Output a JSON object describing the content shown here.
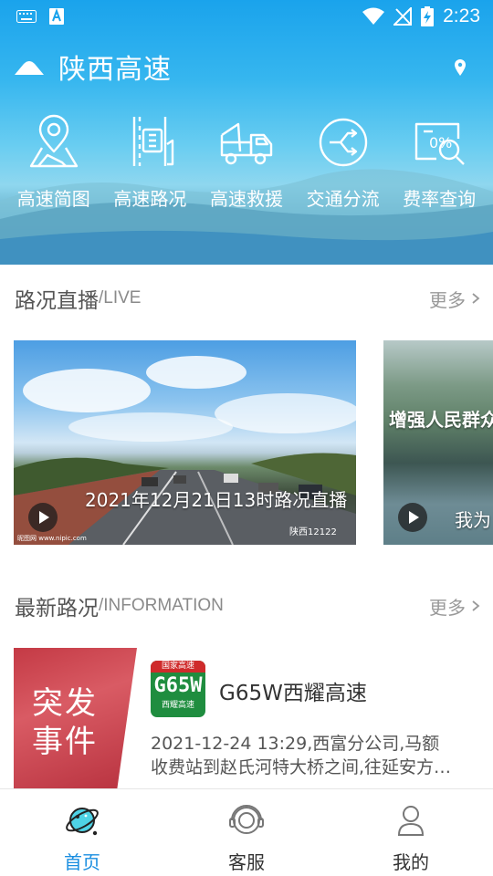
{
  "status_bar": {
    "time": "2:23",
    "left_icons": [
      "keyboard-icon",
      "text-a-icon"
    ],
    "right_icons": [
      "wifi-icon",
      "no-signal-icon",
      "battery-charging-icon"
    ]
  },
  "header": {
    "title": "陕西高速",
    "cloud_icon": "cloud-icon",
    "location_icon": "location-pin-icon"
  },
  "quick_actions": [
    {
      "label": "高速简图",
      "icon": "map-pin-icon"
    },
    {
      "label": "高速路况",
      "icon": "road-condition-icon"
    },
    {
      "label": "高速救援",
      "icon": "tow-truck-icon"
    },
    {
      "label": "交通分流",
      "icon": "diversion-icon"
    },
    {
      "label": "费率查询",
      "icon": "rate-query-icon"
    }
  ],
  "live_section": {
    "title": "路况直播",
    "subtitle": "/LIVE",
    "more": "更多",
    "cards": [
      {
        "title": "2021年12月21日13时路况直播",
        "watermark_left": "昵图网 www.nipic.com",
        "watermark_right": "陕西12122"
      },
      {
        "title_top": "增强人民群众",
        "title_bottom": "我为"
      }
    ]
  },
  "info_section": {
    "title": "最新路况",
    "subtitle": "/INFORMATION",
    "more": "更多",
    "items": [
      {
        "thumb_text": "突发事件",
        "sign_top": "国家高速",
        "sign_code": "G65W",
        "sign_bottom": "西耀高速",
        "name": "G65W西耀高速",
        "desc_line1": "2021-12-24 13:29,西富分公司,马额",
        "desc_line2": "收费站到赵氏河特大桥之间,往延安方…"
      }
    ]
  },
  "bottom_nav": [
    {
      "label": "首页",
      "icon": "planet-icon",
      "active": true
    },
    {
      "label": "客服",
      "icon": "headset-icon",
      "active": false
    },
    {
      "label": "我的",
      "icon": "user-icon",
      "active": false
    }
  ],
  "colors": {
    "accent": "#1a8ee0",
    "header_blue": "#1aa3ec",
    "sign_green": "#1f8d3f",
    "sign_red": "#cf2b2b"
  }
}
